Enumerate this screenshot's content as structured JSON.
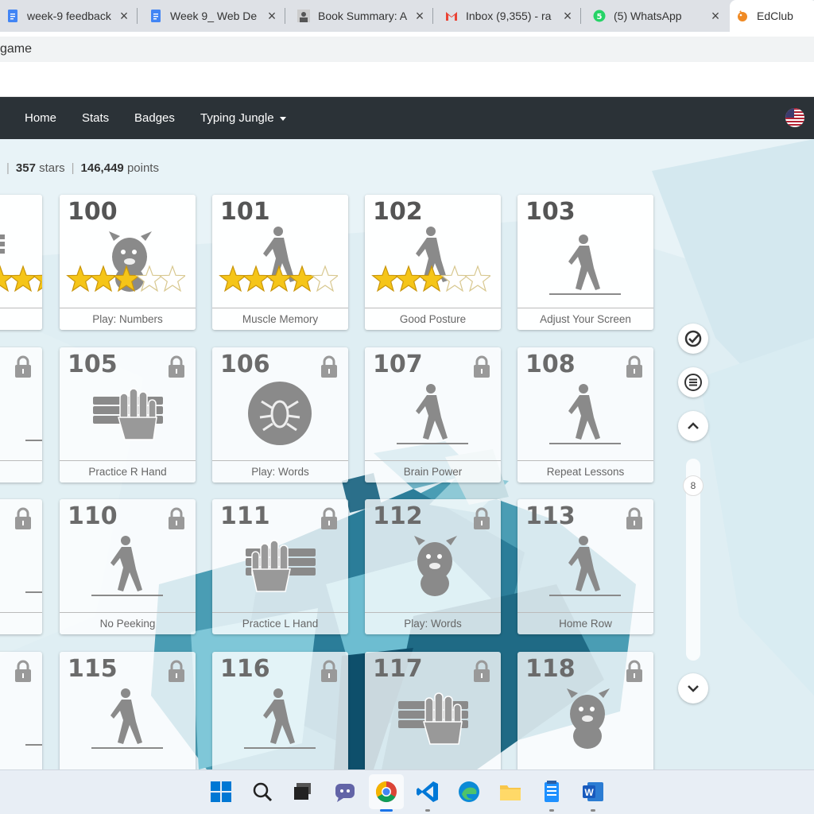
{
  "browser": {
    "tabs": [
      {
        "title": "week-9 feedback",
        "icon": "docs-icon"
      },
      {
        "title": "Week 9_ Web De",
        "icon": "docs-icon"
      },
      {
        "title": "Book Summary: A",
        "icon": "person-avatar-icon"
      },
      {
        "title": "Inbox (9,355) - ra",
        "icon": "gmail-icon"
      },
      {
        "title": "(5) WhatsApp",
        "icon": "whatsapp-icon"
      },
      {
        "title": "EdClub",
        "icon": "edclub-icon"
      }
    ],
    "address": "game"
  },
  "nav": {
    "home": "Home",
    "stats": "Stats",
    "badges": "Badges",
    "jungle": "Typing Jungle"
  },
  "stats": {
    "stars": "357",
    "stars_label": "stars",
    "points": "146,449",
    "points_label": "points"
  },
  "cards": {
    "c99": {
      "label": "and",
      "stars": 3
    },
    "c100": {
      "num": "100",
      "label": "Play: Numbers",
      "stars": 3
    },
    "c101": {
      "num": "101",
      "label": "Muscle Memory",
      "stars": 4
    },
    "c102": {
      "num": "102",
      "label": "Good Posture",
      "stars": 3
    },
    "c103": {
      "num": "103",
      "label": "Adjust Your Screen"
    },
    "c104": {
      "label": "elf"
    },
    "c105": {
      "num": "105",
      "label": "Practice R Hand"
    },
    "c106": {
      "num": "106",
      "label": "Play: Words"
    },
    "c107": {
      "num": "107",
      "label": "Brain Power"
    },
    "c108": {
      "num": "108",
      "label": "Repeat Lessons"
    },
    "c109": {
      "label": "p"
    },
    "c110": {
      "num": "110",
      "label": "No Peeking"
    },
    "c111": {
      "num": "111",
      "label": "Practice L Hand"
    },
    "c112": {
      "num": "112",
      "label": "Play: Words"
    },
    "c113": {
      "num": "113",
      "label": "Home Row"
    },
    "c115": {
      "num": "115"
    },
    "c116": {
      "num": "116"
    },
    "c117": {
      "num": "117"
    },
    "c118": {
      "num": "118"
    }
  },
  "scroll": {
    "page": "8"
  },
  "colors": {
    "nav_bg": "#2b3237",
    "star": "#f5c518",
    "art_gray": "#8a8a8a"
  }
}
